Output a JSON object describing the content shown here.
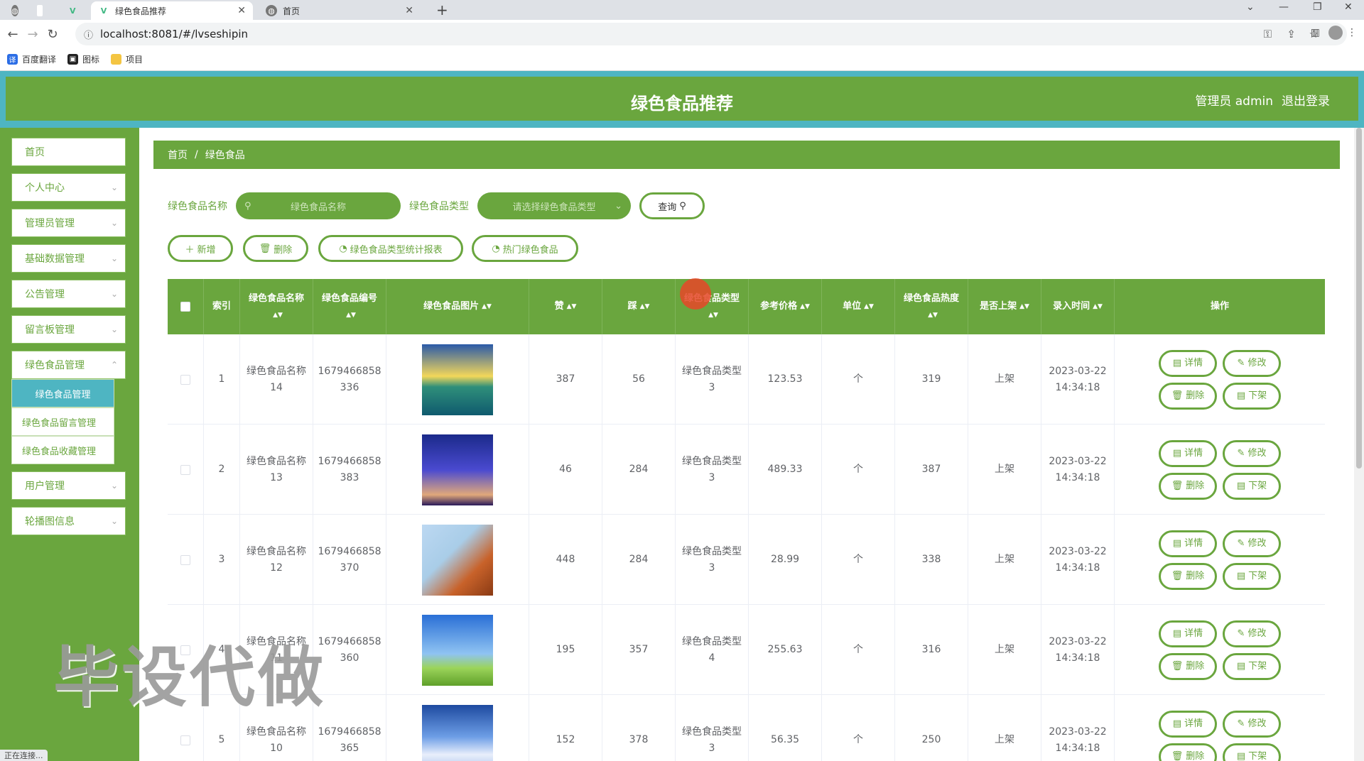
{
  "browser": {
    "tabs": [
      {
        "title": "",
        "icon": "globe-icon"
      },
      {
        "title": "",
        "icon": "blank-icon"
      },
      {
        "title": "",
        "icon": "vue-icon"
      },
      {
        "title": "绿色食品推荐",
        "icon": "vue-icon"
      },
      {
        "title": "首页",
        "icon": "globe-icon"
      }
    ],
    "url": "localhost:8081/#/lvseshipin",
    "bookmarks": [
      "百度翻译",
      "图标",
      "项目"
    ]
  },
  "header": {
    "title": "绿色食品推荐",
    "admin": "管理员 admin",
    "logout": "退出登录"
  },
  "sidebar": {
    "items": [
      "首页",
      "个人中心",
      "管理员管理",
      "基础数据管理",
      "公告管理",
      "留言板管理",
      "绿色食品管理"
    ],
    "sub_items": [
      "绿色食品管理",
      "绿色食品留言管理",
      "绿色食品收藏管理"
    ],
    "items_after": [
      "用户管理",
      "轮播图信息"
    ]
  },
  "breadcrumb": {
    "home": "首页",
    "sep": "/",
    "current": "绿色食品"
  },
  "search": {
    "name_label": "绿色食品名称",
    "name_placeholder": "绿色食品名称",
    "type_label": "绿色食品类型",
    "type_placeholder": "请选择绿色食品类型",
    "query_button": "查询"
  },
  "actions": {
    "add": "新增",
    "delete": "删除",
    "type_report": "绿色食品类型统计报表",
    "hot": "热门绿色食品"
  },
  "table": {
    "headers": [
      "索引",
      "绿色食品名称",
      "绿色食品编号",
      "绿色食品图片",
      "赞",
      "踩",
      "绿色食品类型",
      "参考价格",
      "单位",
      "绿色食品热度",
      "是否上架",
      "录入时间",
      "操作"
    ],
    "rows": [
      {
        "idx": "1",
        "name": "绿色食品名称14",
        "code": "1679466858336",
        "zan": "387",
        "cai": "56",
        "type": "绿色食品类型3",
        "price": "123.53",
        "unit": "个",
        "heat": "319",
        "shelf": "上架",
        "time": "2023-03-22 14:34:18"
      },
      {
        "idx": "2",
        "name": "绿色食品名称13",
        "code": "1679466858383",
        "zan": "46",
        "cai": "284",
        "type": "绿色食品类型3",
        "price": "489.33",
        "unit": "个",
        "heat": "387",
        "shelf": "上架",
        "time": "2023-03-22 14:34:18"
      },
      {
        "idx": "3",
        "name": "绿色食品名称12",
        "code": "1679466858370",
        "zan": "448",
        "cai": "284",
        "type": "绿色食品类型3",
        "price": "28.99",
        "unit": "个",
        "heat": "338",
        "shelf": "上架",
        "time": "2023-03-22 14:34:18"
      },
      {
        "idx": "4",
        "name": "绿色食品名称11",
        "code": "1679466858360",
        "zan": "195",
        "cai": "357",
        "type": "绿色食品类型4",
        "price": "255.63",
        "unit": "个",
        "heat": "316",
        "shelf": "上架",
        "time": "2023-03-22 14:34:18"
      },
      {
        "idx": "5",
        "name": "绿色食品名称10",
        "code": "1679466858365",
        "zan": "152",
        "cai": "378",
        "type": "绿色食品类型3",
        "price": "56.35",
        "unit": "个",
        "heat": "250",
        "shelf": "上架",
        "time": "2023-03-22 14:34:18"
      }
    ],
    "ops": {
      "detail": "详情",
      "edit": "修改",
      "delete": "删除",
      "off": "下架"
    }
  },
  "watermark": "毕设代做",
  "status_bar": "正在连接...",
  "colors": {
    "primary": "#6aa63e",
    "accent": "#4eb5c2"
  }
}
